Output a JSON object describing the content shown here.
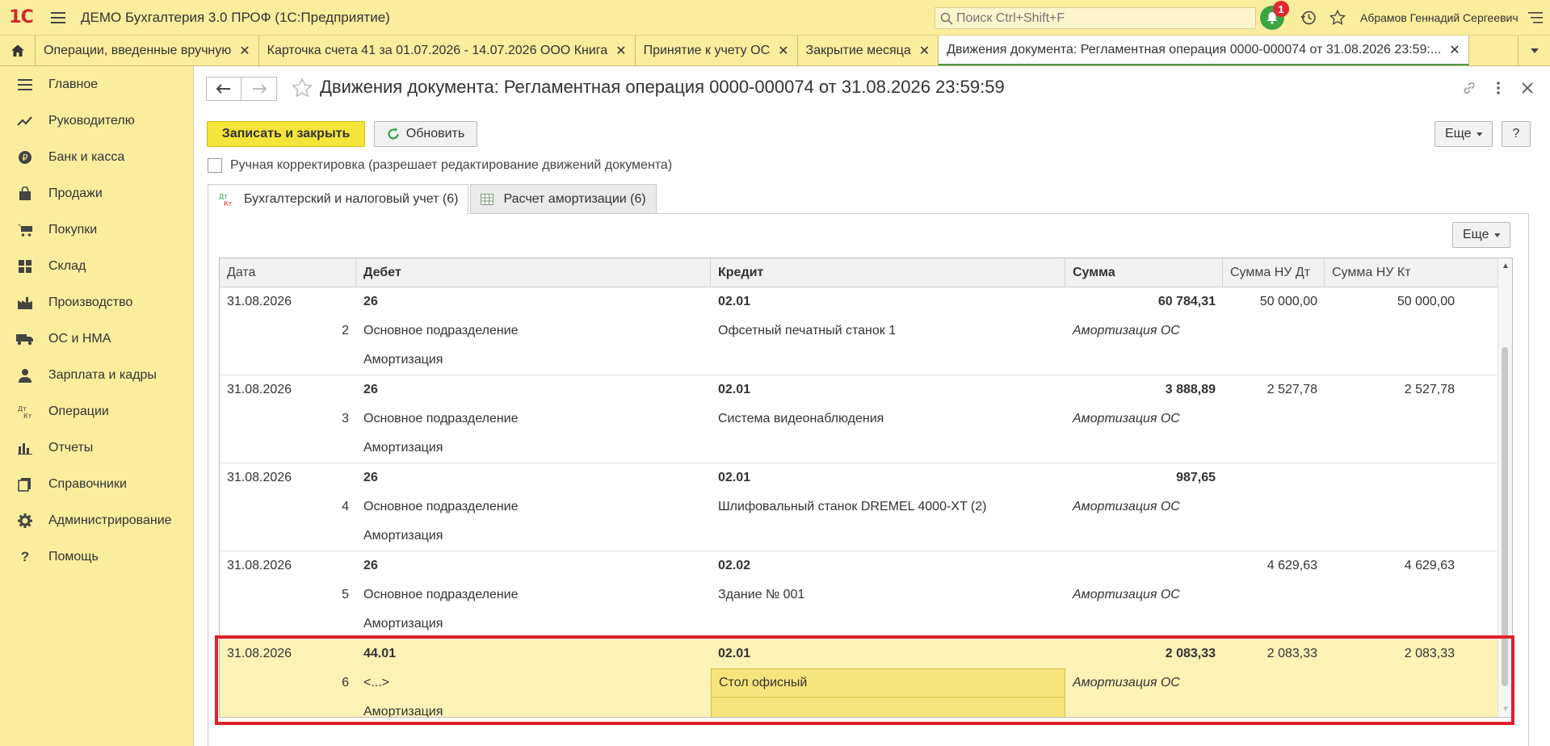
{
  "app": {
    "logo": "1С",
    "title": "ДЕМО Бухгалтерия 3.0 ПРОФ  (1С:Предприятие)",
    "search_placeholder": "Поиск Ctrl+Shift+F",
    "notifications_count": "1",
    "user": "Абрамов Геннадий Сергеевич"
  },
  "tabs": [
    {
      "label": "Операции, введенные вручную"
    },
    {
      "label": "Карточка счета 41 за 01.07.2026 - 14.07.2026 ООО Книга"
    },
    {
      "label": "Принятие к учету ОС"
    },
    {
      "label": "Закрытие месяца"
    },
    {
      "label": "Движения документа: Регламентная операция 0000-000074 от 31.08.2026 23:59:..."
    }
  ],
  "sidebar": {
    "items": [
      {
        "label": "Главное",
        "icon": "menu-lines-icon"
      },
      {
        "label": "Руководителю",
        "icon": "trend-up-icon"
      },
      {
        "label": "Банк и касса",
        "icon": "ruble-coin-icon"
      },
      {
        "label": "Продажи",
        "icon": "shopping-bag-icon"
      },
      {
        "label": "Покупки",
        "icon": "cart-icon"
      },
      {
        "label": "Склад",
        "icon": "warehouse-icon"
      },
      {
        "label": "Производство",
        "icon": "factory-icon"
      },
      {
        "label": "ОС и НМА",
        "icon": "truck-icon"
      },
      {
        "label": "Зарплата и кадры",
        "icon": "person-icon"
      },
      {
        "label": "Операции",
        "icon": "dt-kt-icon"
      },
      {
        "label": "Отчеты",
        "icon": "bar-chart-icon"
      },
      {
        "label": "Справочники",
        "icon": "books-icon"
      },
      {
        "label": "Администрирование",
        "icon": "gear-icon"
      },
      {
        "label": "Помощь",
        "icon": "question-icon"
      }
    ]
  },
  "document": {
    "title": "Движения документа: Регламентная операция 0000-000074 от 31.08.2026 23:59:59",
    "save_close": "Записать и закрыть",
    "refresh": "Обновить",
    "more": "Еще",
    "help": "?",
    "manual_edit": "Ручная корректировка (разрешает редактирование движений документа)"
  },
  "inner_tabs": [
    {
      "label": "Бухгалтерский и налоговый учет (6)"
    },
    {
      "label": "Расчет амортизации (6)"
    }
  ],
  "table": {
    "more": "Еще",
    "headers": {
      "date": "Дата",
      "debit": "Дебет",
      "credit": "Кредит",
      "sum": "Сумма",
      "sum_nu_dt": "Сумма НУ Дт",
      "sum_nu_kt": "Сумма НУ Кт"
    },
    "rows": [
      {
        "date": "31.08.2026",
        "num": "2",
        "debit_acc": "26",
        "debit_sub1": "Основное подразделение",
        "debit_sub2": "Амортизация",
        "credit_acc": "02.01",
        "credit_sub1": "Офсетный печатный станок 1",
        "sum": "60 784,31",
        "content": "Амортизация ОС",
        "nu_dt": "50 000,00",
        "nu_kt": "50 000,00"
      },
      {
        "date": "31.08.2026",
        "num": "3",
        "debit_acc": "26",
        "debit_sub1": "Основное подразделение",
        "debit_sub2": "Амортизация",
        "credit_acc": "02.01",
        "credit_sub1": "Система видеонаблюдения",
        "sum": "3 888,89",
        "content": "Амортизация ОС",
        "nu_dt": "2 527,78",
        "nu_kt": "2 527,78"
      },
      {
        "date": "31.08.2026",
        "num": "4",
        "debit_acc": "26",
        "debit_sub1": "Основное подразделение",
        "debit_sub2": "Амортизация",
        "credit_acc": "02.01",
        "credit_sub1": "Шлифовальный станок DREMEL 4000-XT (2)",
        "sum": "987,65",
        "content": "Амортизация ОС",
        "nu_dt": "",
        "nu_kt": ""
      },
      {
        "date": "31.08.2026",
        "num": "5",
        "debit_acc": "26",
        "debit_sub1": "Основное подразделение",
        "debit_sub2": "Амортизация",
        "credit_acc": "02.02",
        "credit_sub1": "Здание № 001",
        "sum": "",
        "content": "Амортизация ОС",
        "nu_dt": "4 629,63",
        "nu_kt": "4 629,63"
      },
      {
        "date": "31.08.2026",
        "num": "6",
        "debit_acc": "44.01",
        "debit_sub1": "<...>",
        "debit_sub2": "Амортизация",
        "credit_acc": "02.01",
        "credit_sub1": "Стол офисный",
        "sum": "2 083,33",
        "content": "Амортизация ОС",
        "nu_dt": "2 083,33",
        "nu_kt": "2 083,33"
      }
    ]
  },
  "colors": {
    "accent_yellow": "#fbed9e",
    "primary_button": "#f5e43a",
    "highlight_box": "#e0202a",
    "selected_row": "#fbf2b6"
  }
}
